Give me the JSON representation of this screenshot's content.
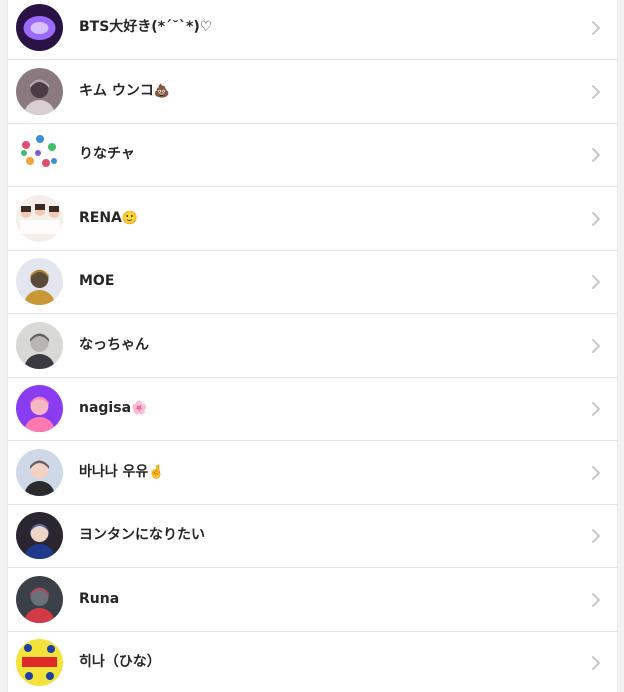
{
  "friends": [
    {
      "name": "BTS大好き(*´˘`*)♡",
      "emoji": "",
      "avatar_icon": "purple-logo-icon",
      "avatar_colors": [
        "#2a1245",
        "#9b6bff",
        "#e8d6ff"
      ]
    },
    {
      "name": "キム ウンコ",
      "emoji": "💩",
      "avatar_icon": "person-photo-icon",
      "avatar_colors": [
        "#8a7a80",
        "#d9cfd3",
        "#4a3c42"
      ]
    },
    {
      "name": "りなチャ",
      "emoji": "",
      "avatar_icon": "colorful-collage-icon",
      "avatar_colors": [
        "#ffffff",
        "#e24b6e",
        "#3a8fd9"
      ]
    },
    {
      "name": "RENA",
      "emoji": "🙂",
      "avatar_icon": "group-photo-icon",
      "avatar_colors": [
        "#f4efe9",
        "#3b2a24",
        "#f1c7b5"
      ]
    },
    {
      "name": "MOE",
      "emoji": "",
      "avatar_icon": "person-photo-icon",
      "avatar_colors": [
        "#e4e6ef",
        "#c99836",
        "#5a4a3a"
      ]
    },
    {
      "name": "なっちゃん",
      "emoji": "",
      "avatar_icon": "person-photo-icon",
      "avatar_colors": [
        "#d8d8d4",
        "#3a3a40",
        "#b8b6b0"
      ]
    },
    {
      "name": "nagisa",
      "emoji": "🌸",
      "avatar_icon": "person-photo-icon",
      "avatar_colors": [
        "#8a3cf0",
        "#ff7ab0",
        "#f7b8c6"
      ]
    },
    {
      "name": "바나나 우유",
      "emoji": "🤞",
      "avatar_icon": "person-photo-icon",
      "avatar_colors": [
        "#cfd8e6",
        "#2b2a2f",
        "#f1d2c4"
      ]
    },
    {
      "name": "ヨンタンになりたい",
      "emoji": "",
      "avatar_icon": "person-photo-icon",
      "avatar_colors": [
        "#2a2630",
        "#1f3a8a",
        "#efd4c8"
      ]
    },
    {
      "name": "Runa",
      "emoji": "",
      "avatar_icon": "person-photo-icon",
      "avatar_colors": [
        "#3b3f47",
        "#d23a48",
        "#6b6f78"
      ]
    },
    {
      "name": "히나（ひな）",
      "emoji": "",
      "avatar_icon": "marvel-pattern-icon",
      "avatar_colors": [
        "#f3e23a",
        "#1b3fa8",
        "#e02a2a"
      ]
    }
  ],
  "chevron_icon": "chevron-right-icon",
  "colors": {
    "text": "#262626",
    "divider": "#e6e6e6",
    "chevron": "#c7c7cc",
    "background": "#ffffff"
  }
}
